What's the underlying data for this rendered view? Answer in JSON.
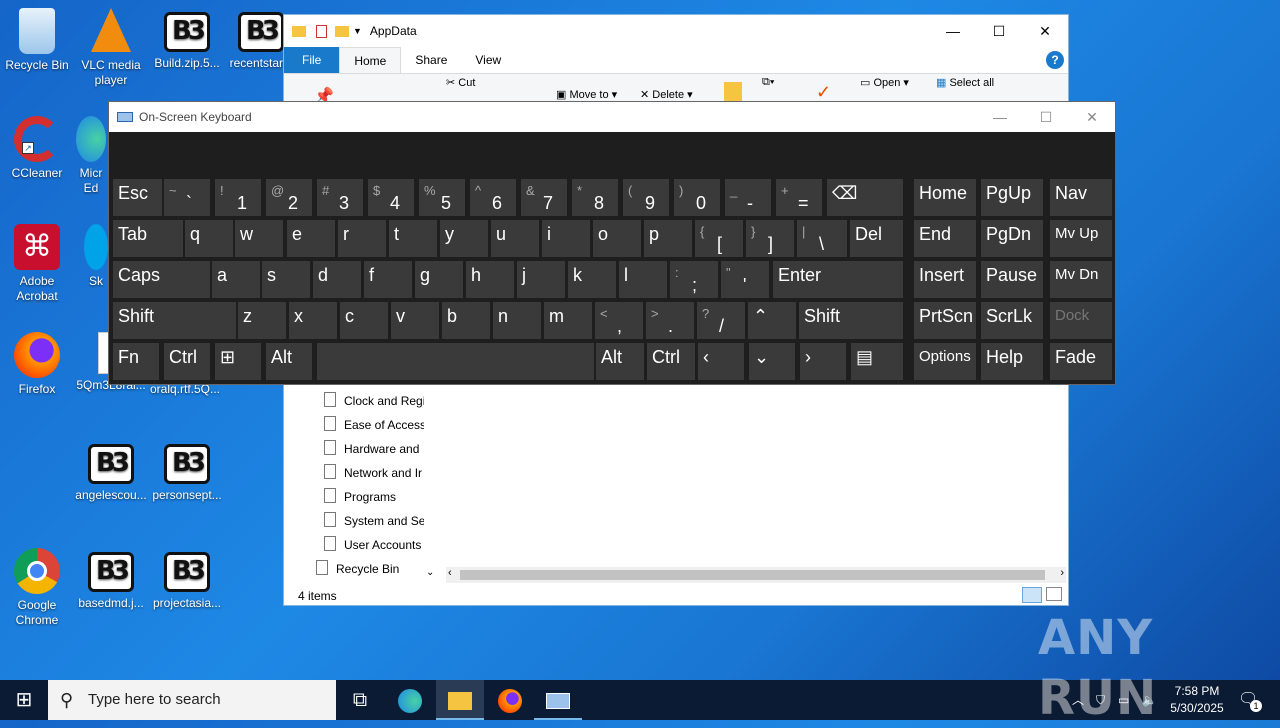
{
  "desktop": {
    "icons": [
      {
        "name": "recycle-bin",
        "label": "Recycle Bin"
      },
      {
        "name": "vlc",
        "label": "VLC media player"
      },
      {
        "name": "build-zip",
        "label": "Build.zip.5..."
      },
      {
        "name": "recentstar",
        "label": "recentstar..."
      },
      {
        "name": "ccleaner",
        "label": "CCleaner"
      },
      {
        "name": "microsoft-edge",
        "label": "Micr Ed"
      },
      {
        "name": "adobe-acrobat",
        "label": "Adobe Acrobat"
      },
      {
        "name": "skype",
        "label": "Sk"
      },
      {
        "name": "firefox",
        "label": "Firefox"
      },
      {
        "name": "file-5qm",
        "label": "5Qm3L8ral..."
      },
      {
        "name": "oralq-rtf",
        "label": "oralq.rtf.5Q..."
      },
      {
        "name": "angelescou",
        "label": "angelescou..."
      },
      {
        "name": "personsept",
        "label": "personsept..."
      },
      {
        "name": "google-chrome",
        "label": "Google Chrome"
      },
      {
        "name": "basedmd",
        "label": "basedmd.j..."
      },
      {
        "name": "projectasia",
        "label": "projectasia..."
      }
    ]
  },
  "explorer": {
    "title": "AppData",
    "tabs": [
      "File",
      "Home",
      "Share",
      "View"
    ],
    "ribbon": {
      "cut": "Cut",
      "move_to": "Move to",
      "delete": "Delete",
      "open": "Open",
      "select_all": "Select all"
    },
    "nav_items": [
      "Clock and Regi",
      "Ease of Access",
      "Hardware and",
      "Network and Ir",
      "Programs",
      "System and Sec",
      "User Accounts",
      "Recycle Bin"
    ],
    "status": "4 items"
  },
  "osk": {
    "title": "On-Screen Keyboard",
    "rows": [
      [
        {
          "l": "Esc"
        },
        {
          "s": "~",
          "l": "`"
        },
        {
          "s": "!",
          "l": "1"
        },
        {
          "s": "@",
          "l": "2"
        },
        {
          "s": "#",
          "l": "3"
        },
        {
          "s": "$",
          "l": "4"
        },
        {
          "s": "%",
          "l": "5"
        },
        {
          "s": "^",
          "l": "6"
        },
        {
          "s": "&",
          "l": "7"
        },
        {
          "s": "*",
          "l": "8"
        },
        {
          "s": "(",
          "l": "9"
        },
        {
          "s": ")",
          "l": "0"
        },
        {
          "s": "_",
          "l": "-"
        },
        {
          "s": "+",
          "l": "="
        },
        {
          "l": "⌫"
        },
        {
          "l": "Home"
        },
        {
          "l": "PgUp"
        },
        {
          "l": "Nav"
        }
      ],
      [
        {
          "l": "Tab"
        },
        {
          "l": "q"
        },
        {
          "l": "w"
        },
        {
          "l": "e"
        },
        {
          "l": "r"
        },
        {
          "l": "t"
        },
        {
          "l": "y"
        },
        {
          "l": "u"
        },
        {
          "l": "i"
        },
        {
          "l": "o"
        },
        {
          "l": "p"
        },
        {
          "s": "{",
          "l": "["
        },
        {
          "s": "}",
          "l": "]"
        },
        {
          "s": "|",
          "l": "\\"
        },
        {
          "l": "Del"
        },
        {
          "l": "End"
        },
        {
          "l": "PgDn"
        },
        {
          "l": "Mv Up"
        }
      ],
      [
        {
          "l": "Caps"
        },
        {
          "l": "a"
        },
        {
          "l": "s"
        },
        {
          "l": "d"
        },
        {
          "l": "f"
        },
        {
          "l": "g"
        },
        {
          "l": "h"
        },
        {
          "l": "j"
        },
        {
          "l": "k"
        },
        {
          "l": "l"
        },
        {
          "s": ":",
          "l": ";"
        },
        {
          "s": "\"",
          "l": "'"
        },
        {
          "l": "Enter"
        },
        {
          "l": "Insert"
        },
        {
          "l": "Pause"
        },
        {
          "l": "Mv Dn"
        }
      ],
      [
        {
          "l": "Shift"
        },
        {
          "l": "z"
        },
        {
          "l": "x"
        },
        {
          "l": "c"
        },
        {
          "l": "v"
        },
        {
          "l": "b"
        },
        {
          "l": "n"
        },
        {
          "l": "m"
        },
        {
          "s": "<",
          "l": ","
        },
        {
          "s": ">",
          "l": "."
        },
        {
          "s": "?",
          "l": "/"
        },
        {
          "l": "⌃"
        },
        {
          "l": "Shift"
        },
        {
          "l": "PrtScn"
        },
        {
          "l": "ScrLk"
        },
        {
          "l": "Dock"
        }
      ],
      [
        {
          "l": "Fn"
        },
        {
          "l": "Ctrl"
        },
        {
          "l": "⊞"
        },
        {
          "l": "Alt"
        },
        {
          "l": ""
        },
        {
          "l": "Alt"
        },
        {
          "l": "Ctrl"
        },
        {
          "l": "‹"
        },
        {
          "l": "⌄"
        },
        {
          "l": "›"
        },
        {
          "l": "▤"
        },
        {
          "l": "Options"
        },
        {
          "l": "Help"
        },
        {
          "l": "Fade"
        }
      ]
    ]
  },
  "taskbar": {
    "search_placeholder": "Type here to search",
    "time": "7:58 PM",
    "date": "5/30/2025",
    "notification_count": "1"
  },
  "watermark": "ANY RUN"
}
